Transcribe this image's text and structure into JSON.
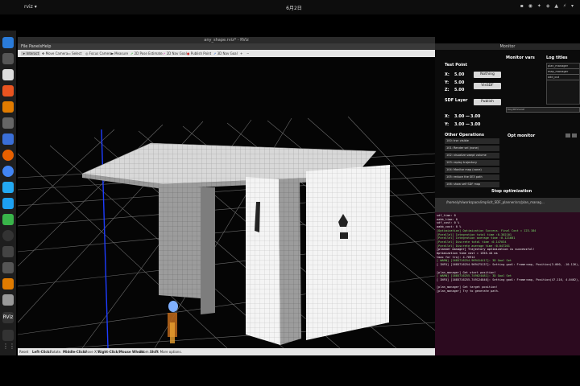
{
  "topbar": {
    "activities": "Activities",
    "app": "rviz",
    "clock": "6月2日",
    "tray": "▪ ◉ ✦ ◈ ▲ ⚡ ▾"
  },
  "rviz": {
    "window_title": "any_shape.rviz* - RViz",
    "menu": [
      "File",
      "Panels",
      "Help"
    ],
    "toolbar": [
      {
        "label": "Interact",
        "icon": "cursor-icon"
      },
      {
        "label": "Move Camera",
        "icon": "camera-icon"
      },
      {
        "label": "Select",
        "icon": "select-icon"
      },
      {
        "label": "Focus Camera",
        "icon": "focus-icon"
      },
      {
        "label": "Measure",
        "icon": "ruler-icon"
      },
      {
        "label": "2D Pose Estimate",
        "icon": "arrow-green-icon"
      },
      {
        "label": "2D Nav Goal",
        "icon": "arrow-pink-icon"
      },
      {
        "label": "Publish Point",
        "icon": "pin-icon"
      },
      {
        "label": "3D Nav Goal",
        "icon": "arrow-blue-icon"
      },
      {
        "label": "+",
        "icon": "plus-icon"
      },
      {
        "label": "−",
        "icon": "minus-icon"
      }
    ],
    "status": {
      "reset": "Reset",
      "hint_bold": "Left-Click:",
      "hint": "Rotate.",
      "hint2_bold": "Middle-Click:",
      "hint2": "Move X/Y.",
      "hint3_bold": "Right-Click/Mouse Wheel:",
      "hint3": "Zoom.",
      "hint4_bold": "Shift",
      "hint4": ": More options.",
      "fps": "31 fps"
    }
  },
  "monitor": {
    "title": "Monitor",
    "test_point": {
      "heading": "Test Point",
      "x_label": "X:",
      "x_value": "5.00",
      "y_label": "Y:",
      "y_value": "5.00",
      "z_label": "Z:",
      "z_value": "5.00",
      "nothing_button": "Nothing",
      "vissdf_button": "VisSDF",
      "publish_button": "Publish"
    },
    "sdf_layer": {
      "heading": "SDF Layer",
      "x_label": "X:",
      "x_value": "3.00",
      "x_sep": "—",
      "x_value2": "3.00",
      "y_label": "Y:",
      "y_value": "3.00",
      "y_sep": "—",
      "y_value2": "3.00"
    },
    "other_ops": {
      "heading": "Other Operations",
      "items": [
        "100: trw: visible",
        "101: Render sel (none)",
        "102: visualize swept volume",
        "103: replay trajectory",
        "104: Monitor map (none)",
        "105: reduce the SE3 path",
        "106: show self SDF map"
      ]
    },
    "monitor_vars": "Monitor vars",
    "log_titles": {
      "heading": "Log titles",
      "items": [
        "plan_manager",
        "map_manager",
        "odd_out"
      ]
    },
    "monitor_bar_label": "TRAJ/MESSAGE",
    "opt_monitor": "Opt monitor",
    "stop_button": "Stop optimization"
  },
  "terminal": {
    "title": "/home/yh/workspace/implicit_SDF_planner/src/plan_manag...",
    "lines": [
      {
        "t": "sdf_time: 0",
        "c": ""
      },
      {
        "t": "aabb_time: 0",
        "c": ""
      },
      {
        "t": "sdf_cost: 0 %",
        "c": ""
      },
      {
        "t": "aabb_cost: 0 %",
        "c": ""
      },
      {
        "t": "[Optimization] Optimization Success. Final Cost = 123.184",
        "c": "green"
      },
      {
        "t": "[Parallel] Integration total time :0.302101",
        "c": "green"
      },
      {
        "t": "[Parallel] Integration average time :0.121601",
        "c": "green"
      },
      {
        "t": "[Parallel] Discrete total time :0.147034",
        "c": "green"
      },
      {
        "t": "[Parallel] Discrete average time :0.047201",
        "c": "green"
      },
      {
        "t": "[planner manager] Trajectory optimization is successful!",
        "c": "bright"
      },
      {
        "t": "Optimization time cost = 1355.44 ms",
        "c": "bright"
      },
      {
        "t": " tmax for traj: 4.76914",
        "c": ""
      },
      {
        "t": "[ WARN] [1685716254.969414417]: 3D Goal Set",
        "c": "green"
      },
      {
        "t": "[ INFO] [1685716254.969475137]: Setting goal: Frame:map, Position(3.000, -10.126), Orientation(0.000, 0.000, 0.000, 1.000) = Angle: 0.000",
        "c": ""
      },
      {
        "t": "",
        "c": ""
      },
      {
        "t": "[plan_manager] Get start position!",
        "c": ""
      },
      {
        "t": "[ WARN] [1685716255.749624481]: 3D Goal Set",
        "c": "green"
      },
      {
        "t": "[ INFO] [1685716255.749124840]: Setting goal: Frame:map, Position(47.116, 4.0462), Orientation(0.000, 0.000, -0.000, 1.000) = Angle: -0.000",
        "c": ""
      },
      {
        "t": "",
        "c": ""
      },
      {
        "t": "[plan_manager] Get target position!",
        "c": ""
      },
      {
        "t": "[plan_manager] Try to generate path.",
        "c": ""
      }
    ]
  }
}
